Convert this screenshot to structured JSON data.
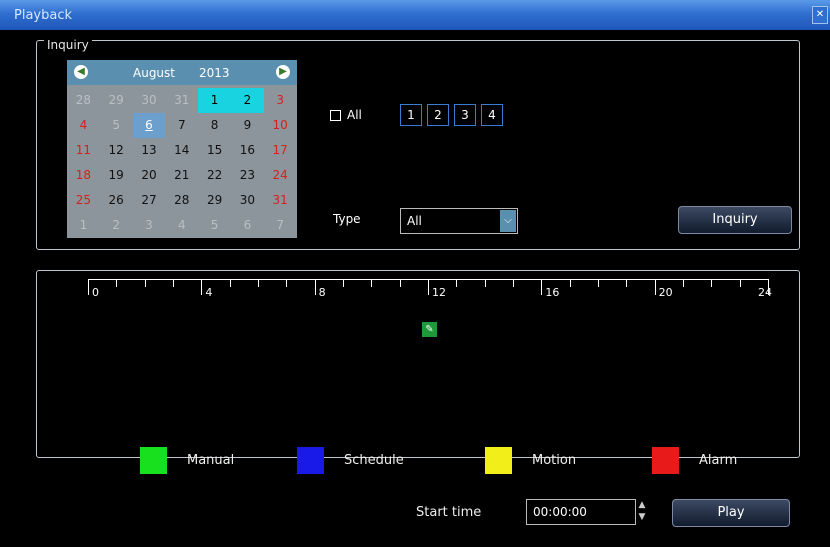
{
  "window": {
    "title": "Playback"
  },
  "inquiry": {
    "group_label": "Inquiry",
    "calendar": {
      "month": "August",
      "year": "2013",
      "rows": [
        [
          {
            "d": "28",
            "s": "muted"
          },
          {
            "d": "29",
            "s": "muted"
          },
          {
            "d": "30",
            "s": "muted"
          },
          {
            "d": "31",
            "s": "muted"
          },
          {
            "d": "1",
            "s": "cyan"
          },
          {
            "d": "2",
            "s": "cyan"
          },
          {
            "d": "3",
            "s": "red"
          }
        ],
        [
          {
            "d": "4",
            "s": "red"
          },
          {
            "d": "5",
            "s": "muted"
          },
          {
            "d": "6",
            "s": "today"
          },
          {
            "d": "7",
            "s": ""
          },
          {
            "d": "8",
            "s": ""
          },
          {
            "d": "9",
            "s": ""
          },
          {
            "d": "10",
            "s": "red"
          }
        ],
        [
          {
            "d": "11",
            "s": "red"
          },
          {
            "d": "12",
            "s": ""
          },
          {
            "d": "13",
            "s": ""
          },
          {
            "d": "14",
            "s": ""
          },
          {
            "d": "15",
            "s": ""
          },
          {
            "d": "16",
            "s": ""
          },
          {
            "d": "17",
            "s": "red"
          }
        ],
        [
          {
            "d": "18",
            "s": "red"
          },
          {
            "d": "19",
            "s": ""
          },
          {
            "d": "20",
            "s": ""
          },
          {
            "d": "21",
            "s": ""
          },
          {
            "d": "22",
            "s": ""
          },
          {
            "d": "23",
            "s": ""
          },
          {
            "d": "24",
            "s": "red"
          }
        ],
        [
          {
            "d": "25",
            "s": "red"
          },
          {
            "d": "26",
            "s": ""
          },
          {
            "d": "27",
            "s": ""
          },
          {
            "d": "28",
            "s": ""
          },
          {
            "d": "29",
            "s": ""
          },
          {
            "d": "30",
            "s": ""
          },
          {
            "d": "31",
            "s": "red"
          }
        ],
        [
          {
            "d": "1",
            "s": "muted"
          },
          {
            "d": "2",
            "s": "muted"
          },
          {
            "d": "3",
            "s": "muted"
          },
          {
            "d": "4",
            "s": "muted"
          },
          {
            "d": "5",
            "s": "muted"
          },
          {
            "d": "6",
            "s": "muted"
          },
          {
            "d": "7",
            "s": "muted"
          }
        ]
      ]
    },
    "all_label": "All",
    "channels": [
      "1",
      "2",
      "3",
      "4"
    ],
    "type_label": "Type",
    "type_value": "All",
    "inquiry_button": "Inquiry"
  },
  "timeline": {
    "labels": [
      "0",
      "4",
      "8",
      "12",
      "16",
      "20",
      "24"
    ]
  },
  "legend": [
    {
      "label": "Manual",
      "color": "#19e01e"
    },
    {
      "label": "Schedule",
      "color": "#1a1ae8"
    },
    {
      "label": "Motion",
      "color": "#f2ee1a"
    },
    {
      "label": "Alarm",
      "color": "#e81a1a"
    }
  ],
  "footer": {
    "start_time_label": "Start time",
    "start_time_value": "00:00:00",
    "play_button": "Play"
  }
}
